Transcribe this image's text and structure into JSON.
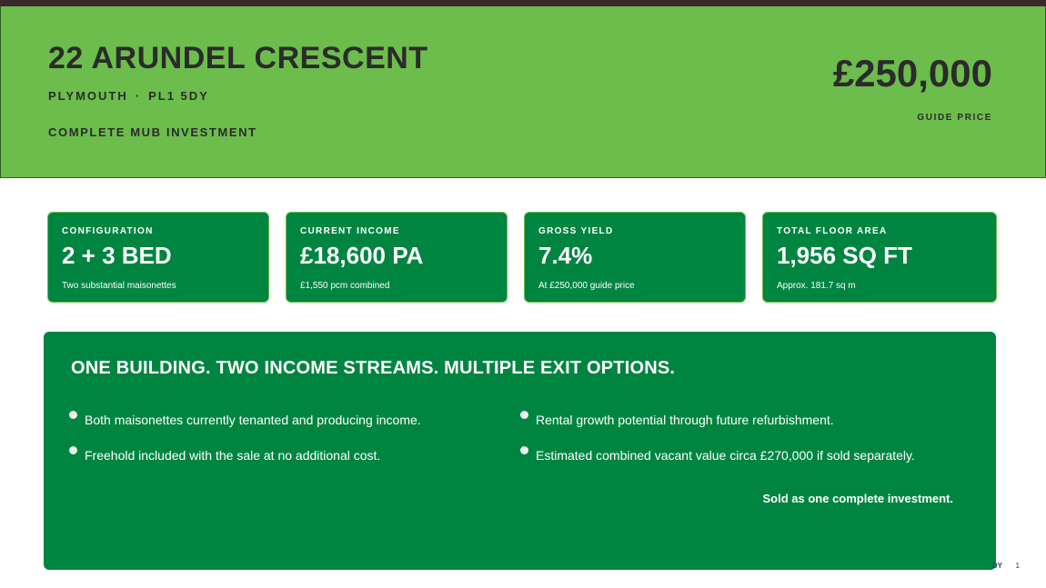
{
  "header": {
    "address": "22 ARUNDEL CRESCENT",
    "city": "PLYMOUTH",
    "separator": "·",
    "postcode": "PL1 5DY",
    "tagline": "COMPLETE MUB INVESTMENT",
    "price": "£250,000",
    "price_label": "GUIDE PRICE"
  },
  "stats": [
    {
      "label": "CONFIGURATION",
      "value": "2 + 3 BED",
      "note": "Two substantial maisonettes"
    },
    {
      "label": "CURRENT INCOME",
      "value": "£18,600 PA",
      "note": "£1,550 pcm combined"
    },
    {
      "label": "GROSS YIELD",
      "value": "7.4%",
      "note": "At £250,000 guide price"
    },
    {
      "label": "TOTAL FLOOR AREA",
      "value": "1,956 SQ FT",
      "note": "Approx. 181.7 sq m"
    }
  ],
  "panel": {
    "heading": "ONE BUILDING. TWO INCOME STREAMS. MULTIPLE EXIT OPTIONS.",
    "bullets": [
      "Both maisonettes currently tenanted and producing income.",
      "Rental growth potential through future refurbishment.",
      "Freehold included with the sale at no additional cost.",
      "Estimated combined vacant value circa £270,000 if sold separately."
    ],
    "closing": "Sold as one complete investment."
  },
  "footer": {
    "right_text": "DY",
    "page": "1"
  },
  "colors": {
    "header_bg": "#6cbd4c",
    "card_bg": "#008541",
    "top_bar": "#3a2a2a",
    "text_dark": "#2b2b2b"
  }
}
